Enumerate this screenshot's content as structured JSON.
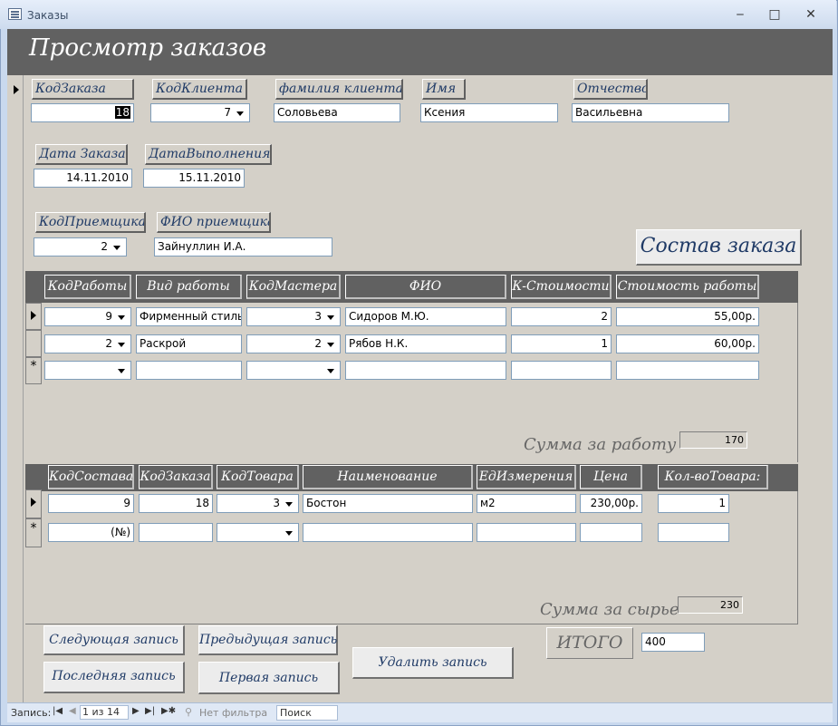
{
  "window": {
    "title": "Заказы",
    "min": "‒",
    "max": "□",
    "close": "✕"
  },
  "form": {
    "title": "Просмотр заказов",
    "labels": {
      "order_id": "КодЗаказа",
      "client_id": "КодКлиента",
      "surname": "фамилия клиента",
      "name": "Имя",
      "patronymic": "Отчество",
      "order_date": "Дата Заказа",
      "done_date": "ДатаВыполнения",
      "receiver_id": "КодПриемщика",
      "receiver_name": "ФИО приемщика"
    },
    "values": {
      "order_id": "18",
      "client_id": "7",
      "surname": "Соловьева",
      "name": "Ксения",
      "patronymic": "Васильевна",
      "order_date": "14.11.2010",
      "done_date": "15.11.2010",
      "receiver_id": "2",
      "receiver_name": "Зайнуллин И.А."
    },
    "composition_button": "Состав заказа"
  },
  "works": {
    "headers": [
      "КодРаботы",
      "Вид работы",
      "КодМастера",
      "ФИО",
      "К-Стоимости",
      "Стоимость работы"
    ],
    "rows": [
      {
        "work_id": "9",
        "kind": "Фирменный стиль",
        "master_id": "3",
        "fio": "Сидоров М.Ю.",
        "k": "2",
        "cost": "55,00р."
      },
      {
        "work_id": "2",
        "kind": "Раскрой",
        "master_id": "2",
        "fio": "Рябов Н.К.",
        "k": "1",
        "cost": "60,00р."
      }
    ],
    "new_row_marker": "*",
    "sum_label": "Сумма за работу",
    "sum_value": "170"
  },
  "materials": {
    "headers": [
      "КодСостава",
      "КодЗаказа",
      "КодТовара",
      "Наименование",
      "ЕдИзмерения",
      "Цена",
      "Кол-воТовара:"
    ],
    "rows": [
      {
        "comp_id": "9",
        "order_id": "18",
        "item_id": "3",
        "name": "Бостон",
        "unit": "м2",
        "price": "230,00р.",
        "qty": "1"
      }
    ],
    "new_row": {
      "comp_id": "(№)"
    },
    "new_row_marker": "*",
    "sum_label": "Сумма за сырье",
    "sum_value": "230"
  },
  "total": {
    "label": "ИТОГО",
    "value": "400"
  },
  "buttons": {
    "next": "Следующая запись",
    "prev": "Предыдущая запись",
    "last": "Последняя запись",
    "first": "Первая запись",
    "delete": "Удалить запись"
  },
  "statusbar": {
    "record_label": "Запись:",
    "position": "1 из 14",
    "filter": "Нет фильтра",
    "search": "Поиск"
  }
}
